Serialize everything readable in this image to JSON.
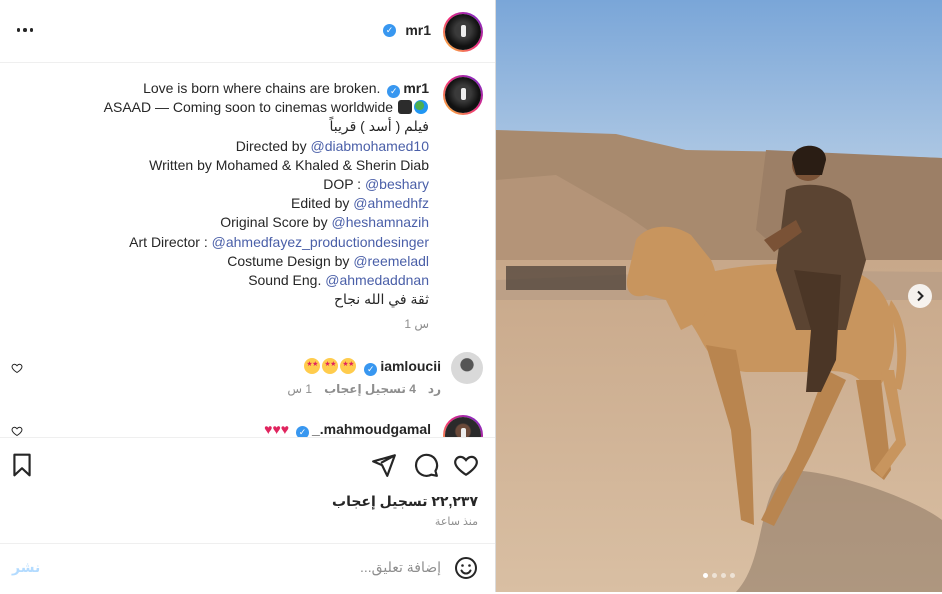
{
  "header": {
    "username": "mr1",
    "verified_icon": "verified-badge-icon",
    "more_icon": "more-options-icon"
  },
  "caption": {
    "username": "mr1",
    "line1": "Love is born where chains are broken.",
    "line2": "ASAAD — Coming soon to cinemas worldwide",
    "line3": "فيلم ( أسد ) قريباً",
    "directed_prefix": "Directed by ",
    "directed_handle": "@diabmohamed10",
    "written": "Written by Mohamed & Khaled & Sherin Diab",
    "dop_prefix": "DOP : ",
    "dop_handle": "@beshary",
    "edited_prefix": "Edited by ",
    "edited_handle": "@ahmedhfz",
    "score_prefix": "Original Score by ",
    "score_handle": "@heshamnazih",
    "art_prefix": "Art Director : ",
    "art_handle": "@ahmedfayez_productiondesinger",
    "costume_prefix": "Costume Design by ",
    "costume_handle": "@reemeladl",
    "sound_prefix": "Sound Eng. ",
    "sound_handle": "@ahmedaddnan",
    "last": "ثقة في الله نجاح",
    "time": "1 س"
  },
  "comments": [
    {
      "username": "iamloucii",
      "time": "1 س",
      "likes": "4 تسجيل إعجاب",
      "reply": "رد"
    },
    {
      "username": "_.mahmoudgamal"
    }
  ],
  "actions": {
    "likes_count": "٢٢,٢٣٧ تسجيل إعجاب",
    "posted_ago": "منذ ساعة"
  },
  "comment_bar": {
    "placeholder": "إضافة تعليق...",
    "post_label": "نشر"
  },
  "media": {
    "slide_count": 4,
    "current_slide": 1,
    "next_icon": "chevron-right-icon"
  }
}
